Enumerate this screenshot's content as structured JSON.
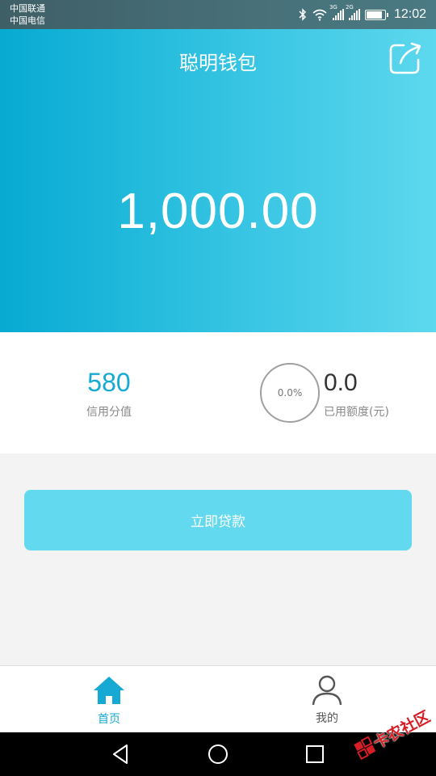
{
  "status_bar": {
    "carrier_1": "中国联通",
    "carrier_2": "中国电信",
    "signal_1_label": "3G",
    "signal_2_label": "2G",
    "time": "12:02",
    "battery_level": 0.9
  },
  "header": {
    "title": "聪明钱包",
    "share_icon": "share-icon"
  },
  "balance": {
    "amount": "1,000.00"
  },
  "stats": {
    "credit_score": "580",
    "credit_label": "信用分值",
    "usage_percent": "0.0%",
    "used_amount": "0.0",
    "used_label": "已用额度(元)"
  },
  "actions": {
    "loan_button": "立即贷款"
  },
  "tabbar": {
    "tabs": [
      {
        "label": "首页",
        "icon": "home-icon",
        "active": true
      },
      {
        "label": "我的",
        "icon": "user-icon",
        "active": false
      }
    ]
  },
  "watermark": {
    "text": "卡农社区"
  },
  "colors": {
    "accent": "#16a9d4",
    "hero_start": "#07aad2",
    "hero_end": "#5dd8ee",
    "button": "#62d9ee"
  }
}
